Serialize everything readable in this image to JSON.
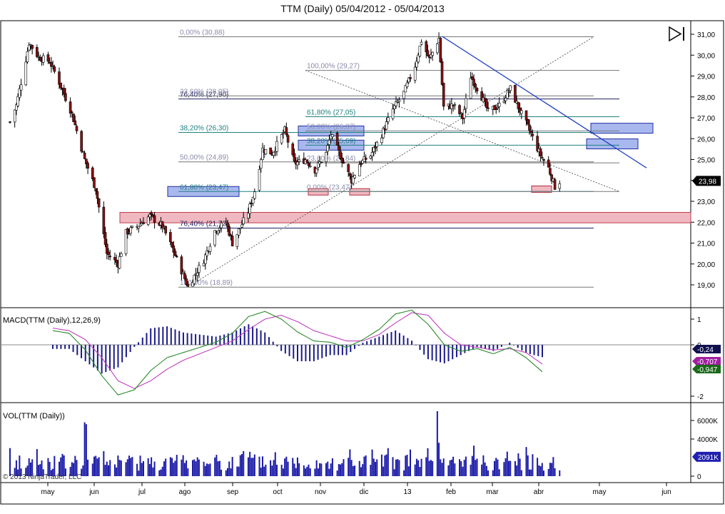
{
  "window": {
    "title": "TTM (Daily)  05/04/2012 - 05/04/2013"
  },
  "copyright": "© 2013 NinjaTrader, LLC",
  "colors": {
    "up_candle": "#ffffff",
    "down_candle": "#8b1010",
    "macd": "#2a8a2a",
    "macd_avg": "#c040c0",
    "macd_hist": "#1a1a8a",
    "volume": "#1a1aa8",
    "trendline": "#2040c0",
    "fib_violet": "#8a8aaa",
    "fib_teal": "#208080",
    "fib_navy": "#202060",
    "fib_red_zone": "#f0b8c0",
    "fib_blue_box": "#a8b8ee"
  },
  "chart_data": [
    {
      "type": "candlestick",
      "title": "TTM (Daily)",
      "x_tick_labels": [
        "may",
        "jun",
        "jul",
        "ago",
        "sep",
        "oct",
        "nov",
        "dic",
        "13",
        "feb",
        "mar",
        "abr",
        "may",
        "jun"
      ],
      "y_ticks": [
        "19,00",
        "20,00",
        "21,00",
        "22,00",
        "23,00",
        "24,00",
        "25,00",
        "26,00",
        "27,00",
        "28,00",
        "29,00",
        "30,00",
        "31,00"
      ],
      "ylim": [
        18.5,
        31.4
      ],
      "last_price": "23,98",
      "path_keypoints": [
        [
          "2012-05-04",
          26.8
        ],
        [
          "2012-05-08",
          27.6
        ],
        [
          "2012-05-14",
          29.8
        ],
        [
          "2012-05-16",
          30.6
        ],
        [
          "2012-05-22",
          29.9
        ],
        [
          "2012-05-29",
          29.7
        ],
        [
          "2012-06-04",
          28.7
        ],
        [
          "2012-06-12",
          27.2
        ],
        [
          "2012-06-20",
          25.0
        ],
        [
          "2012-06-27",
          23.6
        ],
        [
          "2012-07-04",
          20.5
        ],
        [
          "2012-07-11",
          20.0
        ],
        [
          "2012-07-16",
          21.5
        ],
        [
          "2012-07-23",
          21.8
        ],
        [
          "2012-07-31",
          22.3
        ],
        [
          "2012-08-08",
          21.8
        ],
        [
          "2012-08-15",
          20.6
        ],
        [
          "2012-08-22",
          19.3
        ],
        [
          "2012-08-24",
          18.9
        ],
        [
          "2012-09-03",
          20.2
        ],
        [
          "2012-09-10",
          21.6
        ],
        [
          "2012-09-17",
          22.0
        ],
        [
          "2012-09-21",
          21.0
        ],
        [
          "2012-10-01",
          22.5
        ],
        [
          "2012-10-05",
          23.5
        ],
        [
          "2012-10-10",
          25.5
        ],
        [
          "2012-10-16",
          25.3
        ],
        [
          "2012-10-24",
          26.4
        ],
        [
          "2012-10-30",
          24.8
        ],
        [
          "2012-11-06",
          25.0
        ],
        [
          "2012-11-12",
          24.5
        ],
        [
          "2012-11-19",
          25.3
        ],
        [
          "2012-11-22",
          26.2
        ],
        [
          "2012-11-29",
          25.0
        ],
        [
          "2012-12-05",
          24.0
        ],
        [
          "2012-12-10",
          24.8
        ],
        [
          "2012-12-17",
          25.2
        ],
        [
          "2012-12-24",
          26.2
        ],
        [
          "2012-12-31",
          27.4
        ],
        [
          "2013-01-07",
          28.2
        ],
        [
          "2013-01-14",
          29.5
        ],
        [
          "2013-01-18",
          30.7
        ],
        [
          "2013-01-23",
          29.8
        ],
        [
          "2013-01-29",
          30.8
        ],
        [
          "2013-02-01",
          27.5
        ],
        [
          "2013-02-07",
          27.6
        ],
        [
          "2013-02-13",
          27.0
        ],
        [
          "2013-02-18",
          29.0
        ],
        [
          "2013-02-25",
          28.0
        ],
        [
          "2013-03-01",
          27.3
        ],
        [
          "2013-03-08",
          27.6
        ],
        [
          "2013-03-15",
          28.4
        ],
        [
          "2013-03-20",
          27.5
        ],
        [
          "2013-03-27",
          26.4
        ],
        [
          "2013-04-03",
          25.2
        ],
        [
          "2013-04-08",
          24.6
        ],
        [
          "2013-04-12",
          23.7
        ],
        [
          "2013-04-15",
          23.95
        ]
      ],
      "fibonacci_labels": [
        {
          "text": "0,00% (30,88)",
          "value": 30.88,
          "style": "violet"
        },
        {
          "text": "100,00% (29,27)",
          "value": 29.27,
          "style": "violet"
        },
        {
          "text": "76,40% (27,90)",
          "value": 27.9,
          "style": "navy"
        },
        {
          "text": "23,60% (28,05)",
          "value": 28.05,
          "style": "violet"
        },
        {
          "text": "61,80% (27,05)",
          "value": 27.05,
          "style": "teal"
        },
        {
          "text": "50,00% (26,37)",
          "value": 26.37,
          "style": "violet"
        },
        {
          "text": "38,20% (26,30)",
          "value": 26.3,
          "style": "teal"
        },
        {
          "text": "38,20% (25,69)",
          "value": 25.69,
          "style": "teal"
        },
        {
          "text": "50,00% (24,89)",
          "value": 24.89,
          "style": "violet"
        },
        {
          "text": "23,60% (24,84)",
          "value": 24.84,
          "style": "violet"
        },
        {
          "text": "61,80% (23,47)",
          "value": 23.47,
          "style": "teal"
        },
        {
          "text": "0,00% (23,47)",
          "value": 23.47,
          "style": "violet"
        },
        {
          "text": "76,40% (21,72)",
          "value": 21.72,
          "style": "navy"
        },
        {
          "text": "100,00% (18,89)",
          "value": 18.89,
          "style": "violet"
        }
      ]
    },
    {
      "type": "line",
      "title": "MACD(TTM (Daily),12,26,9)",
      "y_ticks": [
        "1",
        "0",
        "-2"
      ],
      "ylim": [
        -2.1,
        1.25
      ],
      "values": {
        "Diff": "-0,24",
        "Avg": "-0,707",
        "MACD": "-0,947"
      },
      "series": [
        {
          "values": [
            0.55,
            0.45,
            -0.2,
            -1.2,
            -1.95,
            -1.75,
            -1.0,
            -0.5,
            -0.3,
            -0.1,
            0.1,
            0.45,
            1.1,
            1.3,
            1.0,
            0.5,
            0.15,
            0.1,
            -0.1,
            0.2,
            0.6,
            1.2,
            1.35,
            0.8,
            0.0,
            -0.25,
            -0.15,
            -0.35,
            -0.1,
            -0.5,
            -1.05
          ]
        },
        {
          "values": [
            0.65,
            0.55,
            0.2,
            -0.5,
            -1.4,
            -1.7,
            -1.4,
            -0.95,
            -0.6,
            -0.35,
            -0.1,
            0.15,
            0.6,
            1.0,
            1.15,
            0.9,
            0.55,
            0.35,
            0.15,
            0.15,
            0.4,
            0.85,
            1.25,
            1.15,
            0.45,
            0.0,
            -0.1,
            -0.2,
            -0.15,
            -0.3,
            -0.75
          ]
        }
      ]
    },
    {
      "type": "bar",
      "title": "VOL(TTM (Daily))",
      "y_ticks": [
        "6000K",
        "4000K",
        "0"
      ],
      "ylim": [
        0,
        7500
      ],
      "last_value": "2091K",
      "peaks_k": [
        {
          "date": "2012-06-20",
          "value": 5800
        },
        {
          "date": "2012-06-21",
          "value": 5600
        },
        {
          "date": "2013-01-28",
          "value": 7000
        },
        {
          "date": "2013-01-29",
          "value": 3600
        }
      ]
    }
  ]
}
